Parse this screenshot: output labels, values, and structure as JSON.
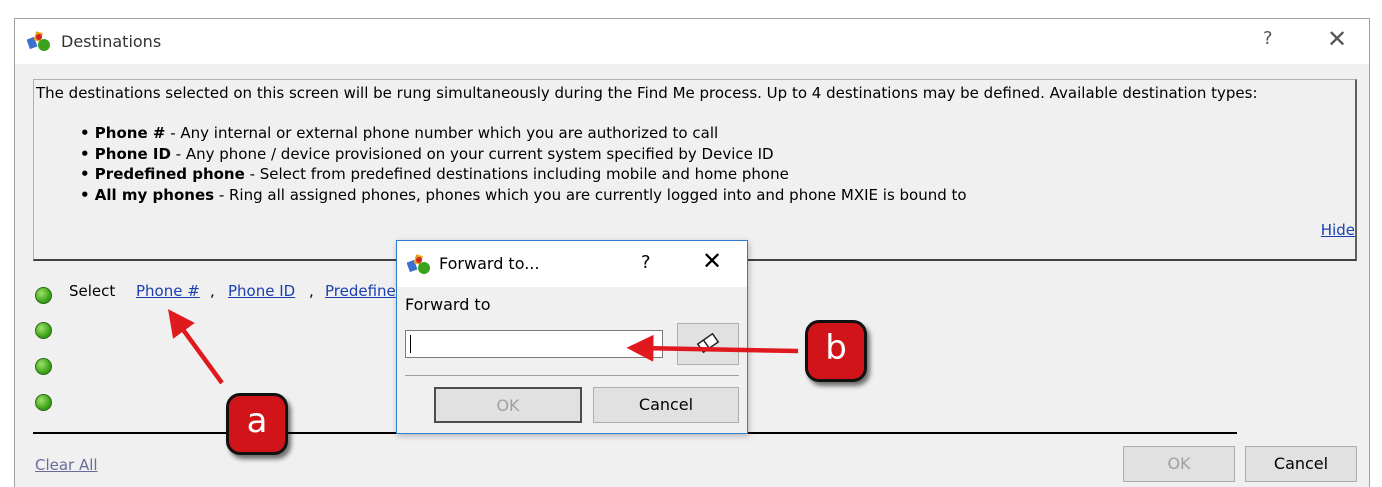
{
  "main_window": {
    "title": "Destinations",
    "help_glyph": "?",
    "close_glyph": "✕"
  },
  "info": {
    "intro": "The destinations selected on this screen will be rung simultaneously during the Find Me process. Up to 4 destinations may be defined. Available destination types:",
    "items": [
      {
        "term": "• Phone #",
        "desc": " - Any internal or external phone number which you are authorized to call"
      },
      {
        "term": "• Phone ID",
        "desc": " - Any phone / device provisioned on your current system specified by Device ID"
      },
      {
        "term": "• Predefined phone",
        "desc": " - Select from predefined destinations including mobile and home phone"
      },
      {
        "term": "• All my phones",
        "desc": " - Ring all assigned phones, phones which you are currently logged into and phone MXIE is bound to"
      }
    ],
    "hide_link": "Hide"
  },
  "destinations": {
    "select_label": "Select",
    "links": [
      "Phone #",
      "Phone ID",
      "Predefine"
    ],
    "separator": ","
  },
  "footer": {
    "clear_all": "Clear All",
    "ok": "OK",
    "cancel": "Cancel"
  },
  "dialog": {
    "title": "Forward to...",
    "help_glyph": "?",
    "close_glyph": "✕",
    "field_label": "Forward to",
    "field_value": "",
    "ok": "OK",
    "cancel": "Cancel"
  },
  "callouts": {
    "a": "a",
    "b": "b"
  },
  "colors": {
    "link": "#1a3fb0",
    "status_dot": "#3ea61a",
    "callout_fill": "#d0141a",
    "arrow": "#e0191f",
    "dialog_border": "#2d7fd2"
  }
}
